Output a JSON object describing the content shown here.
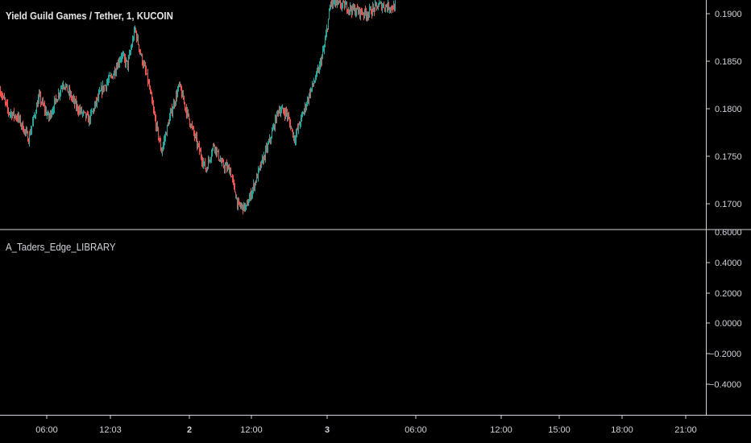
{
  "main_pane": {
    "title": "Yield Guild Games / Tether, 1, KUCOIN",
    "price_ticks": [
      "0.1900",
      "0.1850",
      "0.1800",
      "0.1750",
      "0.1700"
    ]
  },
  "indicator_pane": {
    "title": "A_Taders_Edge_LIBRARY",
    "value_ticks": [
      "0.6000",
      "0.4000",
      "0.2000",
      "0.0000",
      "−0.2000",
      "−0.4000"
    ]
  },
  "time_axis": [
    {
      "label": "06:00",
      "bold": false
    },
    {
      "label": "12:03",
      "bold": false
    },
    {
      "label": "2",
      "bold": true
    },
    {
      "label": "12:00",
      "bold": false
    },
    {
      "label": "3",
      "bold": true
    },
    {
      "label": "06:00",
      "bold": false
    },
    {
      "label": "12:00",
      "bold": false
    },
    {
      "label": "15:00",
      "bold": false
    },
    {
      "label": "18:00",
      "bold": false
    },
    {
      "label": "21:00",
      "bold": false
    }
  ],
  "colors": {
    "background": "#000000",
    "up": "#26a69a",
    "down": "#ef5350",
    "divider": "#d1d4dc",
    "text": "#d1d4dc"
  },
  "chart_data": {
    "type": "candlestick",
    "interval": "1",
    "ylim": [
      0.1695,
      0.1915
    ],
    "price_path": [
      [
        0,
        0.1828
      ],
      [
        10,
        0.1808
      ],
      [
        22,
        0.1802
      ],
      [
        35,
        0.1782
      ],
      [
        48,
        0.1822
      ],
      [
        60,
        0.1802
      ],
      [
        78,
        0.1836
      ],
      [
        95,
        0.1812
      ],
      [
        110,
        0.18
      ],
      [
        125,
        0.1828
      ],
      [
        140,
        0.1844
      ],
      [
        150,
        0.1862
      ],
      [
        158,
        0.1853
      ],
      [
        167,
        0.1887
      ],
      [
        175,
        0.186
      ],
      [
        183,
        0.1838
      ],
      [
        192,
        0.18
      ],
      [
        200,
        0.177
      ],
      [
        210,
        0.1802
      ],
      [
        222,
        0.1833
      ],
      [
        232,
        0.1806
      ],
      [
        243,
        0.178
      ],
      [
        255,
        0.1752
      ],
      [
        265,
        0.1777
      ],
      [
        275,
        0.1757
      ],
      [
        285,
        0.1752
      ],
      [
        295,
        0.1718
      ],
      [
        305,
        0.1716
      ],
      [
        315,
        0.1738
      ],
      [
        325,
        0.176
      ],
      [
        335,
        0.1782
      ],
      [
        345,
        0.181
      ],
      [
        355,
        0.1807
      ],
      [
        365,
        0.1782
      ],
      [
        375,
        0.1805
      ],
      [
        385,
        0.1828
      ],
      [
        395,
        0.1848
      ],
      [
        402,
        0.187
      ],
      [
        410,
        0.1912
      ],
      [
        425,
        0.191
      ],
      [
        440,
        0.1905
      ],
      [
        455,
        0.1902
      ],
      [
        470,
        0.191
      ],
      [
        490,
        0.1908
      ]
    ]
  }
}
